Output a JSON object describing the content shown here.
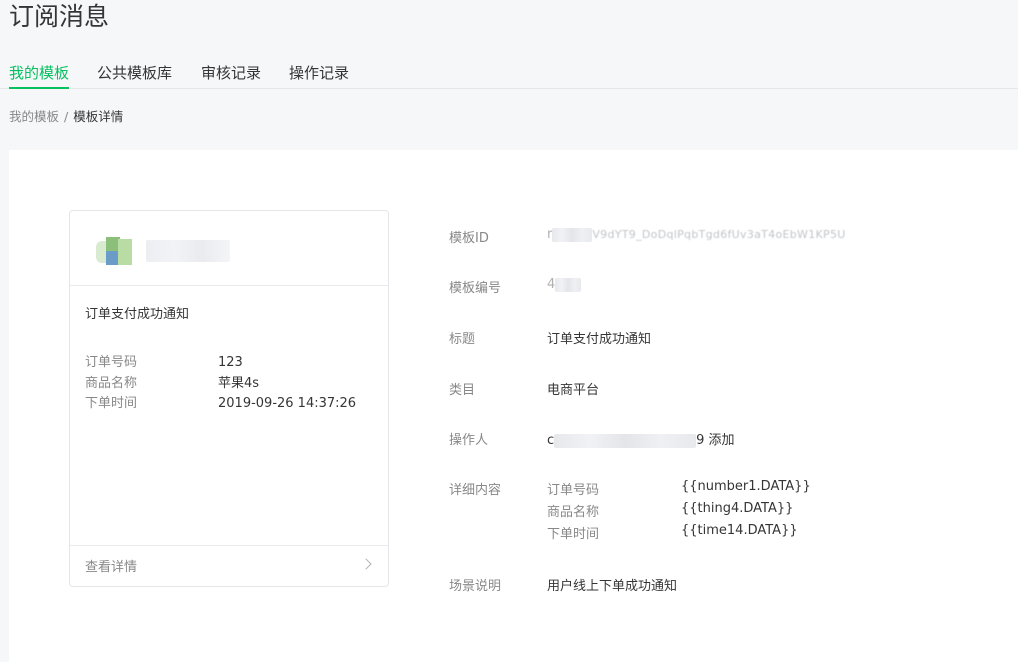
{
  "page_title": "订阅消息",
  "tabs": [
    {
      "label": "我的模板",
      "active": true
    },
    {
      "label": "公共模板库",
      "active": false
    },
    {
      "label": "审核记录",
      "active": false
    },
    {
      "label": "操作记录",
      "active": false
    }
  ],
  "breadcrumb": {
    "parent": "我的模板",
    "separator": "/",
    "current": "模板详情"
  },
  "preview_card": {
    "title": "订单支付成功通知",
    "fields": [
      {
        "key": "订单号码",
        "value": "123"
      },
      {
        "key": "商品名称",
        "value": "苹果4s"
      },
      {
        "key": "下单时间",
        "value": "2019-09-26 14:37:26"
      }
    ],
    "footer_link": "查看详情"
  },
  "details": {
    "template_id_label": "模板ID",
    "template_id_value_prefix": "r",
    "template_id_value_visible": "V9dYT9_DoDqlPqbTgd6fUv3aT4oEbW1KP5U",
    "template_no_label": "模板编号",
    "template_no_value_prefix": "4",
    "title_label": "标题",
    "title_value": "订单支付成功通知",
    "category_label": "类目",
    "category_value": "电商平台",
    "operator_label": "操作人",
    "operator_prefix": "c",
    "operator_suffix": "9 添加",
    "content_label": "详细内容",
    "content_items": [
      {
        "key": "订单号码",
        "value": "{{number1.DATA}}"
      },
      {
        "key": "商品名称",
        "value": "{{thing4.DATA}}"
      },
      {
        "key": "下单时间",
        "value": "{{time14.DATA}}"
      }
    ],
    "scene_label": "场景说明",
    "scene_value": "用户线上下单成功通知"
  },
  "colors": {
    "accent": "#07c160",
    "text": "#353535",
    "muted": "#888888",
    "bg": "#f6f7f9"
  }
}
